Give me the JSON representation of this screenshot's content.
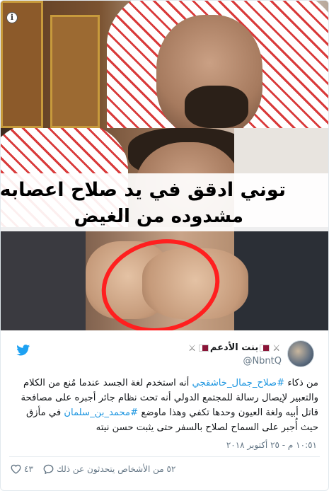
{
  "media": {
    "caption_line1": "توني ادقق في يد صلاح اعصابه",
    "caption_line2": "مشدوده من الغيض",
    "info_icon": "info-icon"
  },
  "author": {
    "display_name_text": "بنت الأدعم",
    "handle": "@NbntQ",
    "icons": [
      "crossed-swords-icon",
      "qatar-flag-icon"
    ]
  },
  "tweet": {
    "text_part1": "من ذكاء ",
    "hashtag1": "#صلاح_جمال_خاشقجي",
    "text_part2": " أنه استخدم لغة الجسد عندما مُنع من الكلام والتعبير لإيصال رسالة للمجتمع الدولي أنه تحت نظام جائر أجبره على مصافحة قاتل أبيه ولغة العيون وحدها تكفي وهذا ماوضع ",
    "hashtag2": "#محمد_بن_سلمان",
    "text_part3": " في مأزق حيث أُجبر على السماح لصلاح بالسفر حتى يثبت حسن نيته",
    "timestamp": "١٠:٥١ م - ٢٥ أكتوبر ٢٠١٨"
  },
  "actions": {
    "like_count": "٤٣",
    "reply_text": "٥٢ من الأشخاص يتحدثون عن ذلك"
  },
  "colors": {
    "link": "#1b95e0",
    "twitter_blue": "#1da1f2",
    "muted": "#657786",
    "highlight_red": "#ff1f1f"
  }
}
